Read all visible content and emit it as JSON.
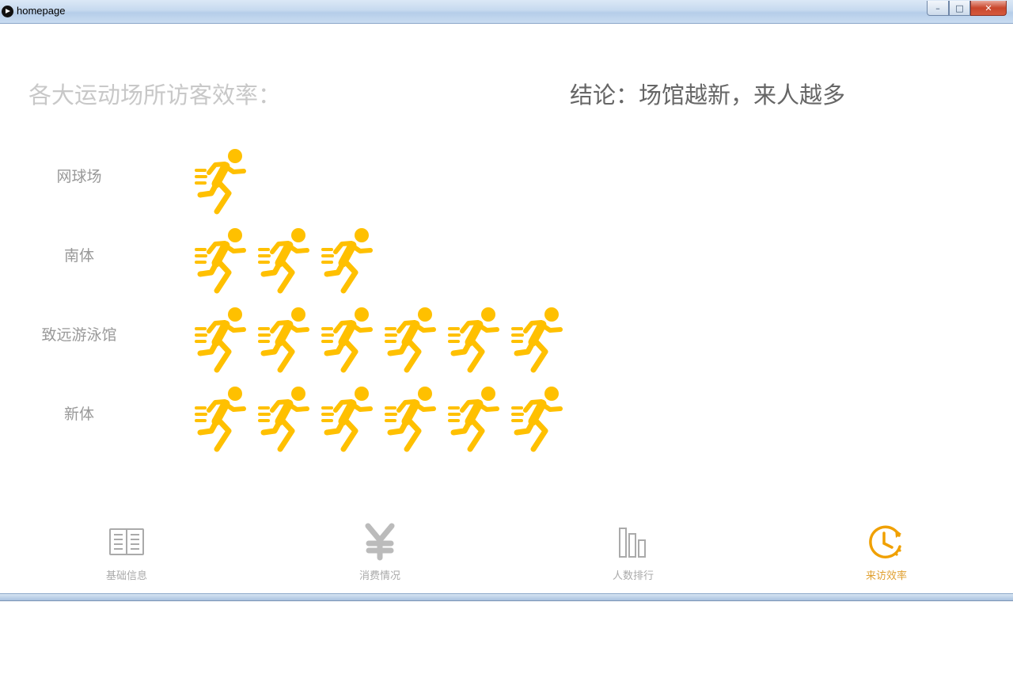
{
  "window": {
    "title": "homepage"
  },
  "heading": {
    "left": "各大运动场所访客效率：",
    "right": "结论：场馆越新，来人越多"
  },
  "colors": {
    "runner": "#FFC000",
    "nav_active": "#E0A030",
    "nav_inactive": "#AAAAAA"
  },
  "rows": [
    {
      "label": "网球场",
      "count": 1
    },
    {
      "label": "南体",
      "count": 3
    },
    {
      "label": "致远游泳馆",
      "count": 6
    },
    {
      "label": "新体",
      "count": 6
    }
  ],
  "nav": [
    {
      "label": "基础信息",
      "icon": "book-icon",
      "active": false
    },
    {
      "label": "消费情况",
      "icon": "yen-icon",
      "active": false
    },
    {
      "label": "人数排行",
      "icon": "bar-chart-icon",
      "active": false
    },
    {
      "label": "来访效率",
      "icon": "clock-icon",
      "active": true
    }
  ]
}
